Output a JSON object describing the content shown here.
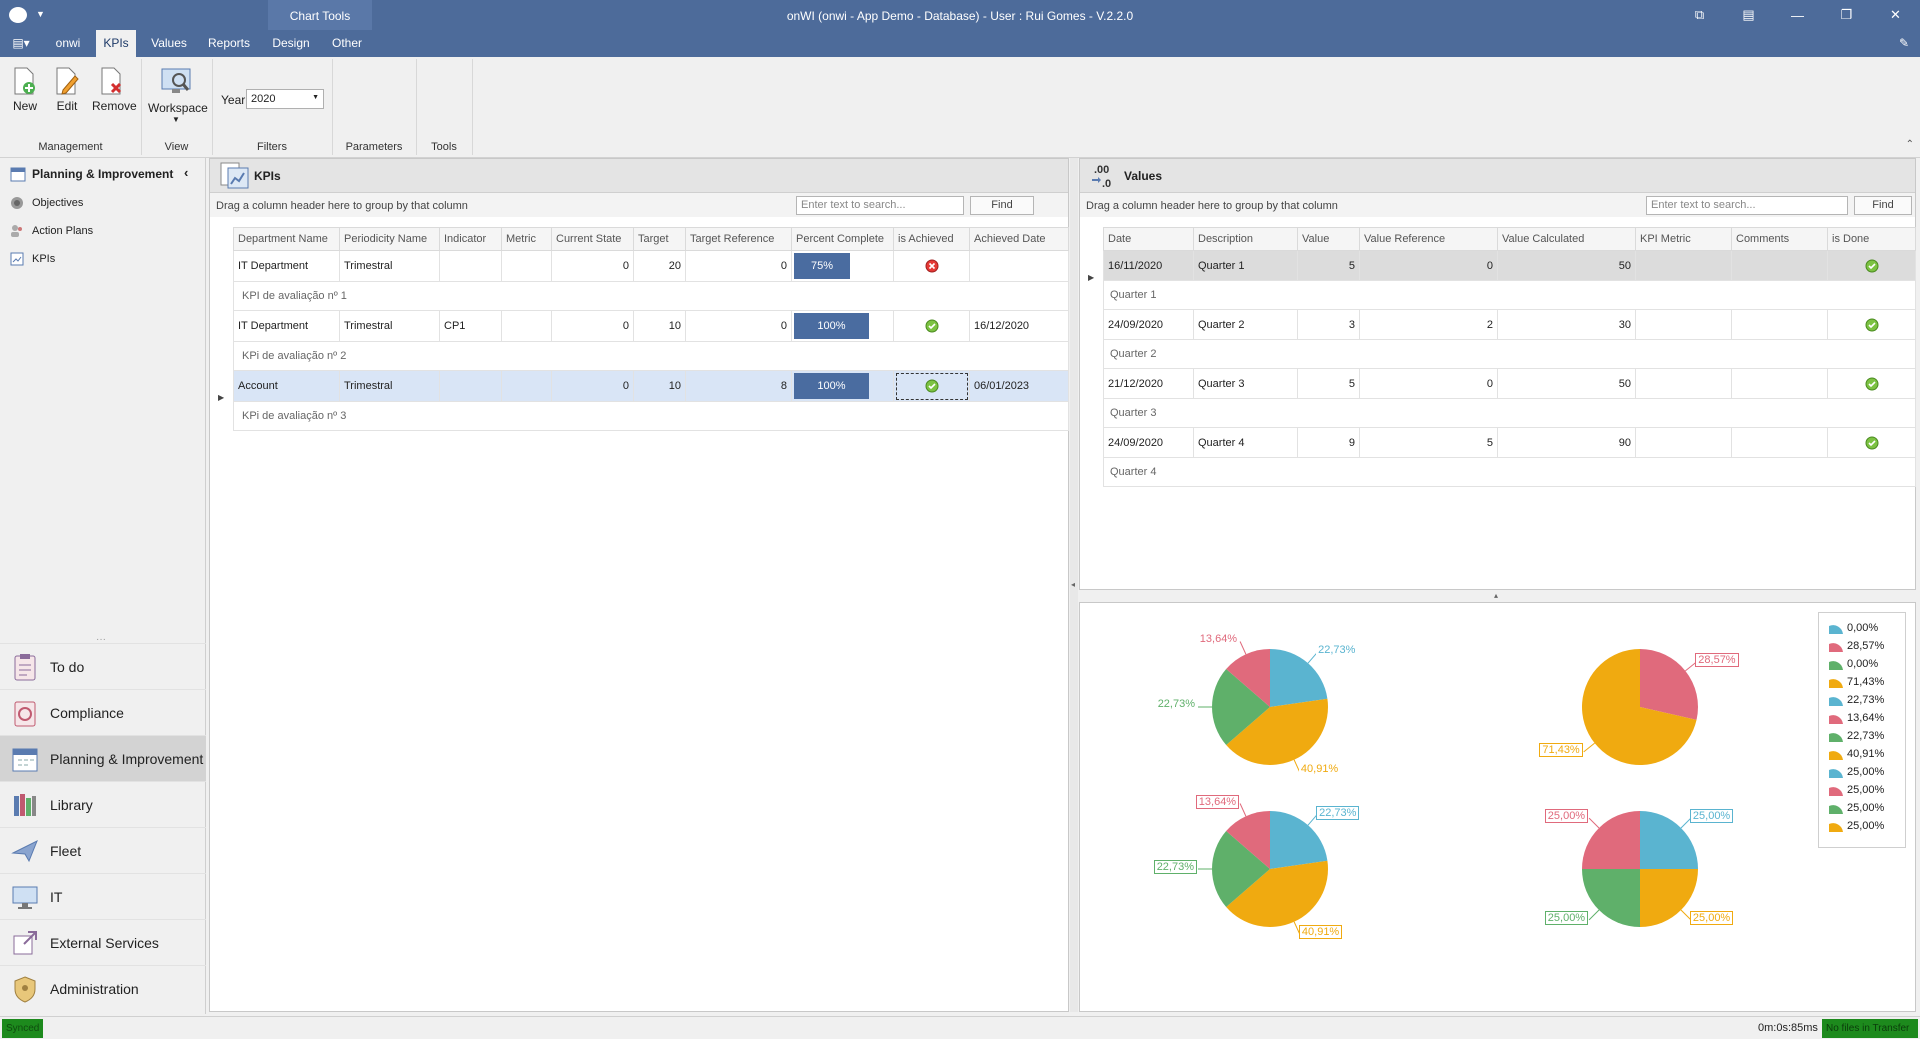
{
  "window": {
    "title": "onWI (onwi - App Demo - Database) - User : Rui Gomes - V.2.2.0",
    "context_tab": "Chart Tools"
  },
  "colors": {
    "titlebar": "#4d6b9a",
    "progress": "#4a6ca0",
    "pie_blue": "#5ab4d0",
    "pie_red": "#e06a7c",
    "pie_green": "#5fb06a",
    "pie_yellow": "#f0aa10"
  },
  "tabs": [
    "onwi",
    "KPIs",
    "Values",
    "Reports",
    "Design",
    "Other"
  ],
  "ribbon": {
    "buttons": {
      "new": "New",
      "edit": "Edit",
      "remove": "Remove",
      "workspace": "Workspace"
    },
    "year_label": "Year",
    "year_value": "2020",
    "groups": {
      "management": "Management",
      "view": "View",
      "filters": "Filters",
      "parameters": "Parameters",
      "tools": "Tools"
    }
  },
  "nav": {
    "header": "Planning & Improvement",
    "items": [
      "Objectives",
      "Action Plans",
      "KPIs"
    ],
    "modules": [
      "To do",
      "Compliance",
      "Planning & Improvement",
      "Library",
      "Fleet",
      "IT",
      "External Services",
      "Administration"
    ]
  },
  "kpis": {
    "title": "KPIs",
    "group_hint": "Drag a column header here to group by that column",
    "search_placeholder": "Enter text to search...",
    "find": "Find",
    "columns": [
      "Department Name",
      "Periodicity Name",
      "Indicator",
      "Metric",
      "Current State",
      "Target",
      "Target Reference",
      "Percent Complete",
      "is Achieved",
      "Achieved Date"
    ],
    "rows": [
      {
        "department": "IT Department",
        "periodicity": "Trimestral",
        "indicator": "",
        "metric": "",
        "current_state": "0",
        "target": "20",
        "target_reference": "0",
        "percent": "75%",
        "percent_value": 75,
        "achieved": false,
        "achieved_date": "",
        "description": "KPI de avaliação nº 1"
      },
      {
        "department": "IT Department",
        "periodicity": "Trimestral",
        "indicator": "CP1",
        "metric": "",
        "current_state": "0",
        "target": "10",
        "target_reference": "0",
        "percent": "100%",
        "percent_value": 100,
        "achieved": true,
        "achieved_date": "16/12/2020",
        "description": "KPi de avaliação nº 2"
      },
      {
        "department": "Account",
        "periodicity": "Trimestral",
        "indicator": "",
        "metric": "",
        "current_state": "0",
        "target": "10",
        "target_reference": "8",
        "percent": "100%",
        "percent_value": 100,
        "achieved": true,
        "achieved_date": "06/01/2023",
        "description": "KPi de avaliação nº 3"
      }
    ]
  },
  "values": {
    "title": "Values",
    "icon_text": ".00\n.0",
    "group_hint": "Drag a column header here to group by that column",
    "search_placeholder": "Enter text to search...",
    "find": "Find",
    "columns": [
      "Date",
      "Description",
      "Value",
      "Value Reference",
      "Value Calculated",
      "KPI Metric",
      "Comments",
      "is Done"
    ],
    "rows": [
      {
        "date": "16/11/2020",
        "description": "Quarter 1",
        "value": "5",
        "value_reference": "0",
        "value_calculated": "50",
        "done": true,
        "note": "Quarter 1"
      },
      {
        "date": "24/09/2020",
        "description": "Quarter 2",
        "value": "3",
        "value_reference": "2",
        "value_calculated": "30",
        "done": true,
        "note": "Quarter 2"
      },
      {
        "date": "21/12/2020",
        "description": "Quarter 3",
        "value": "5",
        "value_reference": "0",
        "value_calculated": "50",
        "done": true,
        "note": "Quarter 3"
      },
      {
        "date": "24/09/2020",
        "description": "Quarter 4",
        "value": "9",
        "value_reference": "5",
        "value_calculated": "90",
        "done": true,
        "note": "Quarter 4"
      }
    ]
  },
  "chart_data": [
    {
      "type": "pie",
      "slices": [
        {
          "color": "blue",
          "value": 22.73,
          "label": "22,73%"
        },
        {
          "color": "yellow",
          "value": 40.91,
          "label": "40,91%"
        },
        {
          "color": "green",
          "value": 22.73,
          "label": "22,73%"
        },
        {
          "color": "red",
          "value": 13.64,
          "label": "13,64%"
        }
      ]
    },
    {
      "type": "pie",
      "slices": [
        {
          "color": "blue",
          "value": 0,
          "label": "0,00%"
        },
        {
          "color": "red",
          "value": 28.57,
          "label": "28,57%"
        },
        {
          "color": "green",
          "value": 0,
          "label": "0,00%"
        },
        {
          "color": "yellow",
          "value": 71.43,
          "label": "71,43%"
        }
      ]
    },
    {
      "type": "pie",
      "slices": [
        {
          "color": "blue",
          "value": 22.73,
          "label": "22,73%"
        },
        {
          "color": "yellow",
          "value": 40.91,
          "label": "40,91%"
        },
        {
          "color": "green",
          "value": 22.73,
          "label": "22,73%"
        },
        {
          "color": "red",
          "value": 13.64,
          "label": "13,64%"
        }
      ]
    },
    {
      "type": "pie",
      "slices": [
        {
          "color": "blue",
          "value": 25.0,
          "label": "25,00%"
        },
        {
          "color": "yellow",
          "value": 25.0,
          "label": "25,00%"
        },
        {
          "color": "green",
          "value": 25.0,
          "label": "25,00%"
        },
        {
          "color": "red",
          "value": 25.0,
          "label": "25,00%"
        }
      ]
    }
  ],
  "legend": [
    {
      "color": "blue",
      "label": "0,00%"
    },
    {
      "color": "red",
      "label": "28,57%"
    },
    {
      "color": "green",
      "label": "0,00%"
    },
    {
      "color": "yellow",
      "label": "71,43%"
    },
    {
      "color": "blue",
      "label": "22,73%"
    },
    {
      "color": "red",
      "label": "13,64%"
    },
    {
      "color": "green",
      "label": "22,73%"
    },
    {
      "color": "yellow",
      "label": "40,91%"
    },
    {
      "color": "blue",
      "label": "25,00%"
    },
    {
      "color": "red",
      "label": "25,00%"
    },
    {
      "color": "green",
      "label": "25,00%"
    },
    {
      "color": "yellow",
      "label": "25,00%"
    }
  ],
  "status": {
    "left": "Synced",
    "elapsed": "0m:0s:85ms",
    "transfer": "No files in Transfer"
  }
}
